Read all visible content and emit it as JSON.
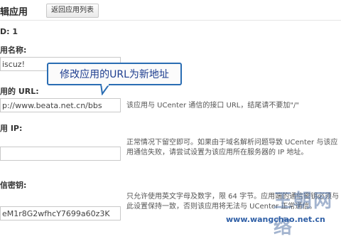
{
  "header": {
    "title": "辑应用",
    "back_button": "返回应用列表"
  },
  "app": {
    "id_label": "D: 1"
  },
  "fields": {
    "name": {
      "label": "用名称:",
      "value": "iscuz!"
    },
    "url": {
      "label": "用的 URL:",
      "value": "p://www.beata.net.cn/bbs",
      "help": "该应用与 UCenter 通信的接口 URL，结尾请不要加\"/\""
    },
    "ip": {
      "label": "用 IP:",
      "value": "",
      "help": "正常情况下留空即可。如果由于域名解析问题导致 UCenter 与该应用通信失败，请尝试设置为该应用所在服务器的 IP 地址。"
    },
    "key": {
      "label": "信密钥:",
      "value": "eM1r8G2wfhcY7699a60z3K",
      "help": "只允许使用英文字母及数字，限 64 字节。应用端的通信密钥必须与此设置保持一致，否则该应用将无法与 UCenter 正常通信。"
    }
  },
  "tooltip": {
    "text": "修改应用的URL为新地址"
  },
  "watermark": {
    "logo": "王朝网络",
    "url": "www.wangchao.net.cn"
  }
}
